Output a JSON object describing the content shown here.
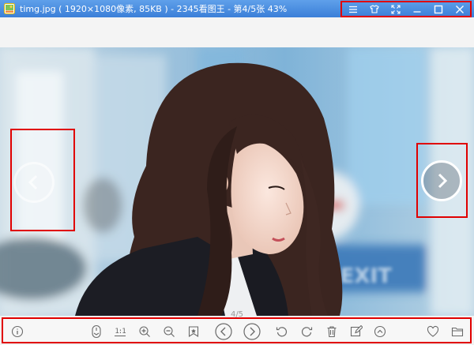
{
  "window": {
    "title": "timg.jpg ( 1920×1080像素, 85KB ) - 2345看图王 - 第4/5张 43%"
  },
  "viewer": {
    "page_indicator": "4/5",
    "ratio_label": "1:1"
  },
  "icons": {
    "title_bar": [
      "menu-icon",
      "skin-icon",
      "fullscreen-icon",
      "minimize-icon",
      "maximize-icon",
      "close-icon"
    ],
    "toolbar": [
      "info-icon",
      "mouse-icon",
      "actual-size-icon",
      "zoom-in-icon",
      "zoom-out-icon",
      "bookmark-icon",
      "previous-icon",
      "next-icon",
      "rotate-left-icon",
      "rotate-right-icon",
      "delete-icon",
      "edit-icon",
      "more-icon",
      "favorite-icon",
      "folder-icon"
    ]
  },
  "colors": {
    "titlebar": "#4a8ee2",
    "highlight": "#e00000",
    "icon": "#6a6a6a"
  }
}
